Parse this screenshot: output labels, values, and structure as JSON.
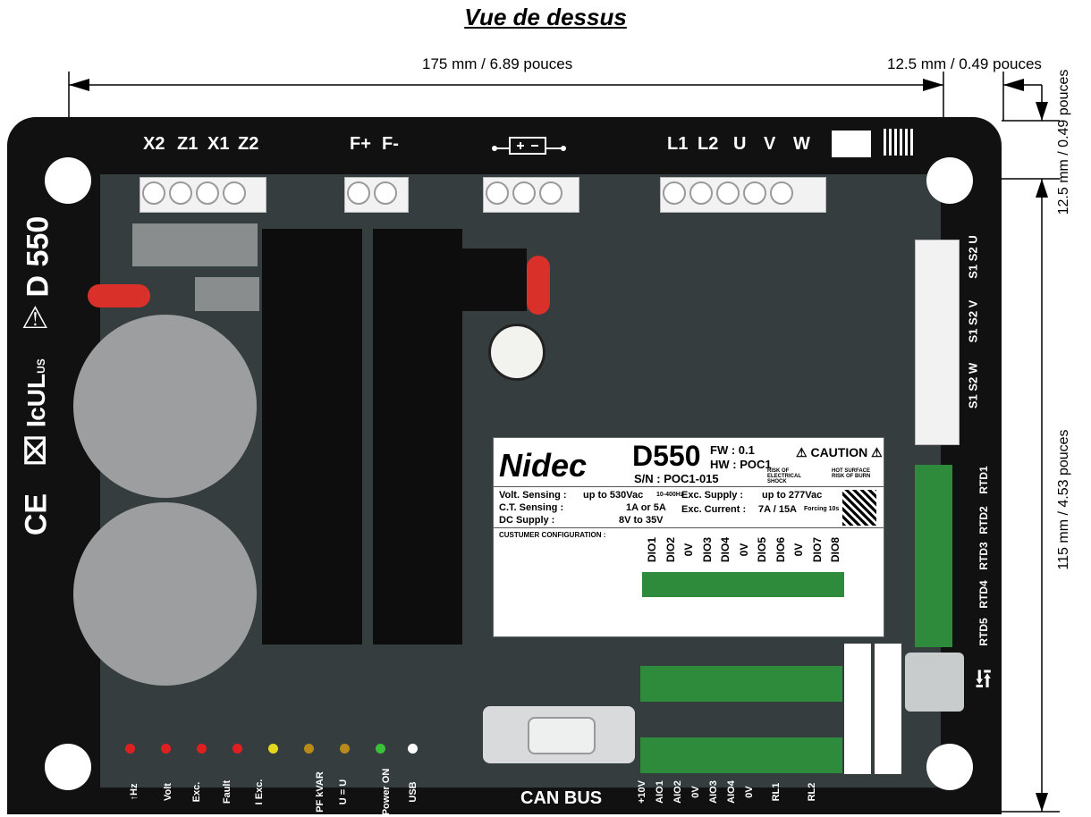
{
  "title": "Vue de dessus",
  "dimensions": {
    "width_top": "175 mm / 6.89 pouces",
    "offset_top": "12.5 mm / 0.49 pouces",
    "offset_right": "12.5 mm / 0.49 pouces",
    "height_right": "115 mm / 4.53 pouces"
  },
  "board": {
    "model_side": "D 550",
    "top_terminals": [
      "X2",
      "Z1",
      "X1",
      "Z2",
      "F+",
      "F-",
      "L1",
      "L2",
      "U",
      "V",
      "W"
    ],
    "right_ct_labels": [
      "S2",
      "S1",
      "U",
      "S2",
      "S1",
      "V",
      "S2",
      "S1",
      "W"
    ],
    "rtd_labels": [
      "RTD1",
      "RTD2",
      "RTD3",
      "RTD4",
      "RTD5"
    ],
    "bottom_labels": [
      "↑Hz",
      "Volt",
      "Exc.",
      "Fault",
      "I Exc.",
      "PF kVAR",
      "U = U",
      "Power ON",
      "USB"
    ],
    "bottom_can": "CAN BUS",
    "bottom_io": [
      "+10V",
      "AIO1",
      "AIO2",
      "0V",
      "AIO3",
      "AIO4",
      "0V",
      "RL1",
      "RL2"
    ],
    "led_colors": [
      "#e02020",
      "#e02020",
      "#e02020",
      "#e02020",
      "#e6d820",
      "#b88a1a",
      "#b88a1a",
      "#3cc03c",
      "#ffffff"
    ],
    "cert_marks": [
      "CE",
      "c",
      "US"
    ]
  },
  "nameplate": {
    "brand": "Nidec",
    "model": "D550",
    "fw": "FW : 0.1",
    "hw": "HW : POC1",
    "sn": "S/N : POC1-015",
    "caution": "CAUTION",
    "risk_shock": "RISK OF ELECTRICAL SHOCK",
    "risk_burn": "HOT SURFACE RISK OF BURN",
    "volt_sensing_label": "Volt. Sensing :",
    "volt_sensing_value": "up to 530Vac",
    "volt_sensing_freq": "10-400Hz",
    "ct_sensing_label": "C.T. Sensing :",
    "ct_sensing_value": "1A or 5A",
    "dc_supply_label": "DC Supply :",
    "dc_supply_value": "8V to 35V",
    "exc_supply_label": "Exc. Supply :",
    "exc_supply_value": "up to 277Vac",
    "exc_current_label": "Exc. Current :",
    "exc_current_value": "7A / 15A",
    "exc_current_note": "Forcing 10s",
    "config_label": "CUSTUMER CONFIGURATION :",
    "dio": [
      "DIO1",
      "DIO2",
      "0V",
      "DIO3",
      "DIO4",
      "0V",
      "DIO5",
      "DIO6",
      "0V",
      "DIO7",
      "DIO8"
    ]
  }
}
